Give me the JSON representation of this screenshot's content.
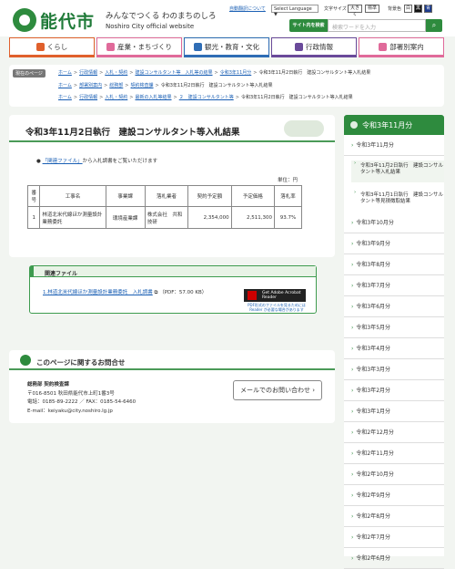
{
  "header": {
    "logo_text": "能代市",
    "tagline": "みんなでつくる わのまちのしろ",
    "site_en": "Noshiro City official website",
    "auto_translate_link": "自動翻訳について",
    "select_language": "Select Language ▼",
    "font_size_label": "文字サイズ",
    "font_large": "大きく",
    "font_standard": "標準",
    "bg_color_label": "背景色",
    "bg_white": "白",
    "bg_black": "黒",
    "bg_blue": "青",
    "search_label": "サイト内を検索",
    "search_placeholder": "検索ワードを入力",
    "search_icon": "search-icon"
  },
  "nav": [
    {
      "label": "くらし",
      "color": "#e0602c"
    },
    {
      "label": "産業・まちづくり",
      "color": "#e06a9a"
    },
    {
      "label": "観光・教育・文化",
      "color": "#2f6db5"
    },
    {
      "label": "行政情報",
      "color": "#6a4a9a"
    },
    {
      "label": "部署別案内",
      "color": "#e06a9a"
    }
  ],
  "breadcrumbs": {
    "label": "現在のページ",
    "row1": [
      "ホーム",
      "行政情報",
      "入札・契約",
      "建設コンサルタント等　入札等の結果",
      "令和3年11月分",
      "令和3年11月2日執行　建設コンサルタント等入札結果"
    ],
    "row2": [
      "ホーム",
      "部署別案内",
      "総務部",
      "契約検査課",
      "令和3年11月2日執行　建設コンサルタント等入札結果"
    ],
    "row3": [
      "ホーム",
      "行政情報",
      "入札・契約",
      "最新の入札等結果",
      "２　建設コンサルタント等",
      "令和3年11月2日執行　建設コンサルタント等入札結果"
    ]
  },
  "main": {
    "title": "令和3年11月2日執行　建設コンサルタント等入札結果",
    "intro_link": "「関連ファイル」",
    "intro_text": "から入札調書をご覧いただけます",
    "unit": "単位：円",
    "table": {
      "headers": [
        "番号",
        "工事名",
        "事業課",
        "落札業者",
        "契約予定額",
        "予定価格",
        "落札率"
      ],
      "rows": [
        [
          "1",
          "林道北米代線ほか測量設計業務委託",
          "環境産業課",
          "株式会社　共和技研",
          "2,354,000",
          "2,511,300",
          "93.7%"
        ]
      ]
    }
  },
  "related": {
    "heading": "関連ファイル",
    "file_link": "1.林道北米代線ほか測量設計業務委託　入札調書",
    "file_meta": "（PDF：57.00 KB）",
    "adobe_btn": "Get Adobe Acrobat Reader",
    "adobe_note": "PDF形式のファイルを見るためにはReader が必要な場合があります"
  },
  "inquiry": {
    "heading": "このページに関するお問合せ",
    "dept": "総務部 契約検査課",
    "address": "〒016-8501 秋田県能代市上町1番3号",
    "phone": "電話：0185-89-2222 ／ FAX：0185-54-6460",
    "email": "E-mail：keiyaku@city.noshiro.lg.jp",
    "mail_button": "メールでのお問い合わせ ›"
  },
  "sidebar": {
    "title": "令和3年11月分",
    "current": "令和3年11月分",
    "sub": [
      "令和3年11月2日執行　建設コンサルタント等入札結果",
      "令和3年11月1日執行　建設コンサルタント等見積徴取結果"
    ],
    "months": [
      "令和3年10月分",
      "令和3年9月分",
      "令和3年8月分",
      "令和3年7月分",
      "令和3年6月分",
      "令和3年5月分",
      "令和3年4月分",
      "令和3年3月分",
      "令和3年2月分",
      "令和3年1月分",
      "令和2年12月分",
      "令和2年11月分",
      "令和2年10月分",
      "令和2年9月分",
      "令和2年8月分",
      "令和2年7月分",
      "令和2年6月分"
    ]
  }
}
